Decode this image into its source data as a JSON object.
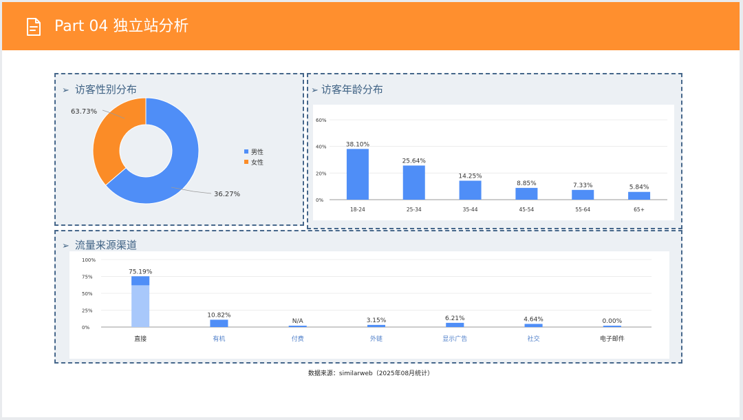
{
  "header": {
    "title": "Part 04 独立站分析",
    "icon": "document-icon"
  },
  "gender_panel": {
    "title": "访客性别分布"
  },
  "age_panel": {
    "title": "访客年龄分布"
  },
  "traffic_panel": {
    "title": "流量来源渠道"
  },
  "footer": {
    "source": "数据来源：similarweb（2025年08月统计）"
  },
  "colors": {
    "header": "#ff8f2e",
    "blue": "#4f8ef7",
    "orange": "#fb8c27",
    "light_blue": "#a8c8fb",
    "panel_border": "#45668a",
    "panel_bg": "#ecf0f4"
  },
  "chart_data": [
    {
      "type": "pie",
      "variant": "donut",
      "categories": [
        "男性",
        "女性"
      ],
      "values": [
        63.73,
        36.27
      ],
      "data_labels": [
        "63.73%",
        "36.27%"
      ],
      "legend": [
        "男性",
        "女性"
      ],
      "legend_position": "right"
    },
    {
      "type": "bar",
      "categories": [
        "18-24",
        "25-34",
        "35-44",
        "45-54",
        "55-64",
        "65+"
      ],
      "values": [
        38.1,
        25.64,
        14.25,
        8.85,
        7.33,
        5.84
      ],
      "data_labels": [
        "38.10%",
        "25.64%",
        "14.25%",
        "8.85%",
        "7.33%",
        "5.84%"
      ],
      "yticks": [
        "0%",
        "20%",
        "40%",
        "60%"
      ],
      "ylim": [
        0,
        60
      ],
      "grid": true
    },
    {
      "type": "bar",
      "categories": [
        "直接",
        "有机",
        "付费",
        "外链",
        "显示广告",
        "社交",
        "电子邮件"
      ],
      "values": [
        75.19,
        10.82,
        0,
        3.15,
        6.21,
        4.64,
        0.0
      ],
      "data_labels": [
        "75.19%",
        "10.82%",
        "N/A",
        "3.15%",
        "6.21%",
        "4.64%",
        "0.00%"
      ],
      "yticks": [
        "0%",
        "25%",
        "50%",
        "75%",
        "100%"
      ],
      "ylim": [
        0,
        100
      ],
      "grid": true
    }
  ]
}
